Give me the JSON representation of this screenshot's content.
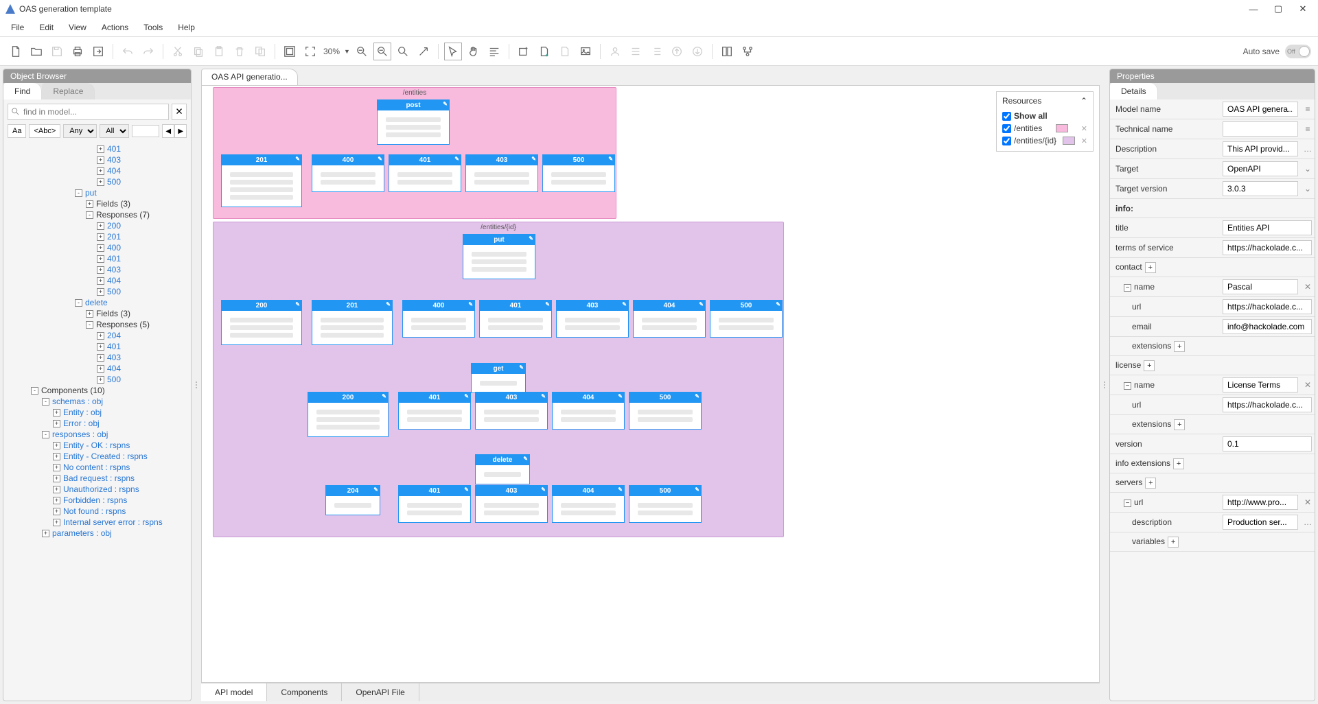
{
  "window": {
    "title": "OAS generation template"
  },
  "menu": [
    "File",
    "Edit",
    "View",
    "Actions",
    "Tools",
    "Help"
  ],
  "toolbar": {
    "zoom": "30%",
    "autosave_label": "Auto save",
    "autosave_state": "Off"
  },
  "objectBrowser": {
    "header": "Object Browser",
    "tabs": {
      "find": "Find",
      "replace": "Replace"
    },
    "search_placeholder": "find in model...",
    "filters": {
      "aa": "Aa",
      "abc": "<Abc>",
      "any": "Any",
      "all": "All"
    },
    "tree": [
      {
        "indent": 132,
        "expand": "+",
        "label": "401",
        "link": true
      },
      {
        "indent": 132,
        "expand": "+",
        "label": "403",
        "link": true
      },
      {
        "indent": 132,
        "expand": "+",
        "label": "404",
        "link": true
      },
      {
        "indent": 132,
        "expand": "+",
        "label": "500",
        "link": true
      },
      {
        "indent": 100,
        "expand": "-",
        "label": "put",
        "link": true
      },
      {
        "indent": 116,
        "expand": "+",
        "label": "Fields (3)",
        "link": false
      },
      {
        "indent": 116,
        "expand": "-",
        "label": "Responses (7)",
        "link": false
      },
      {
        "indent": 132,
        "expand": "+",
        "label": "200",
        "link": true
      },
      {
        "indent": 132,
        "expand": "+",
        "label": "201",
        "link": true
      },
      {
        "indent": 132,
        "expand": "+",
        "label": "400",
        "link": true
      },
      {
        "indent": 132,
        "expand": "+",
        "label": "401",
        "link": true
      },
      {
        "indent": 132,
        "expand": "+",
        "label": "403",
        "link": true
      },
      {
        "indent": 132,
        "expand": "+",
        "label": "404",
        "link": true
      },
      {
        "indent": 132,
        "expand": "+",
        "label": "500",
        "link": true
      },
      {
        "indent": 100,
        "expand": "-",
        "label": "delete",
        "link": true
      },
      {
        "indent": 116,
        "expand": "+",
        "label": "Fields (3)",
        "link": false
      },
      {
        "indent": 116,
        "expand": "-",
        "label": "Responses (5)",
        "link": false
      },
      {
        "indent": 132,
        "expand": "+",
        "label": "204",
        "link": true
      },
      {
        "indent": 132,
        "expand": "+",
        "label": "401",
        "link": true
      },
      {
        "indent": 132,
        "expand": "+",
        "label": "403",
        "link": true
      },
      {
        "indent": 132,
        "expand": "+",
        "label": "404",
        "link": true
      },
      {
        "indent": 132,
        "expand": "+",
        "label": "500",
        "link": true
      },
      {
        "indent": 36,
        "expand": "-",
        "label": "Components (10)",
        "link": false
      },
      {
        "indent": 52,
        "expand": "-",
        "label": "schemas : obj",
        "link": true
      },
      {
        "indent": 68,
        "expand": "+",
        "label": "Entity : obj",
        "link": true
      },
      {
        "indent": 68,
        "expand": "+",
        "label": "Error : obj",
        "link": true
      },
      {
        "indent": 52,
        "expand": "-",
        "label": "responses : obj",
        "link": true
      },
      {
        "indent": 68,
        "expand": "+",
        "label": "Entity - OK : rspns",
        "link": true
      },
      {
        "indent": 68,
        "expand": "+",
        "label": "Entity - Created : rspns",
        "link": true
      },
      {
        "indent": 68,
        "expand": "+",
        "label": "No content : rspns",
        "link": true
      },
      {
        "indent": 68,
        "expand": "+",
        "label": "Bad request : rspns",
        "link": true
      },
      {
        "indent": 68,
        "expand": "+",
        "label": "Unauthorized : rspns",
        "link": true
      },
      {
        "indent": 68,
        "expand": "+",
        "label": "Forbidden : rspns",
        "link": true
      },
      {
        "indent": 68,
        "expand": "+",
        "label": "Not found : rspns",
        "link": true
      },
      {
        "indent": 68,
        "expand": "+",
        "label": "Internal server error : rspns",
        "link": true
      },
      {
        "indent": 52,
        "expand": "+",
        "label": "parameters : obj",
        "link": true,
        "cutoff": true
      }
    ]
  },
  "center": {
    "tab": "OAS API generatio...",
    "resources": {
      "title": "Resources",
      "show_all": "Show all",
      "entities": "/entities",
      "entitiesid": "/entities/{id}"
    },
    "containers": {
      "entities": {
        "label": "/entities"
      },
      "entitiesid": {
        "label": "/entities/{id}"
      }
    },
    "boxes": {
      "post": "post",
      "put": "put",
      "get": "get",
      "delete": "delete",
      "c200": "200",
      "c201": "201",
      "c204": "204",
      "c400": "400",
      "c401": "401",
      "c403": "403",
      "c404": "404",
      "c500": "500"
    },
    "bottom_tabs": [
      "API model",
      "Components",
      "OpenAPI File"
    ]
  },
  "properties": {
    "header": "Properties",
    "details_tab": "Details",
    "rows": {
      "model_name_l": "Model name",
      "model_name_v": "OAS API genera...",
      "technical_name_l": "Technical name",
      "description_l": "Description",
      "description_v": "This API provid...",
      "target_l": "Target",
      "target_v": "OpenAPI",
      "target_version_l": "Target version",
      "target_version_v": "3.0.3",
      "info_l": "info:",
      "title_l": "title",
      "title_v": "Entities API",
      "tos_l": "terms of service",
      "tos_v": "https://hackolade.c...",
      "contact_l": "contact",
      "contact_name_l": "name",
      "contact_name_v": "Pascal",
      "contact_url_l": "url",
      "contact_url_v": "https://hackolade.c...",
      "contact_email_l": "email",
      "contact_email_v": "info@hackolade.com",
      "contact_ext_l": "extensions",
      "license_l": "license",
      "license_name_l": "name",
      "license_name_v": "License Terms",
      "license_url_l": "url",
      "license_url_v": "https://hackolade.c...",
      "license_ext_l": "extensions",
      "version_l": "version",
      "version_v": "0.1",
      "info_ext_l": "info extensions",
      "servers_l": "servers",
      "server_url_l": "url",
      "server_url_v": "http://www.pro...",
      "server_desc_l": "description",
      "server_desc_v": "Production ser...",
      "server_vars_l": "variables"
    }
  }
}
